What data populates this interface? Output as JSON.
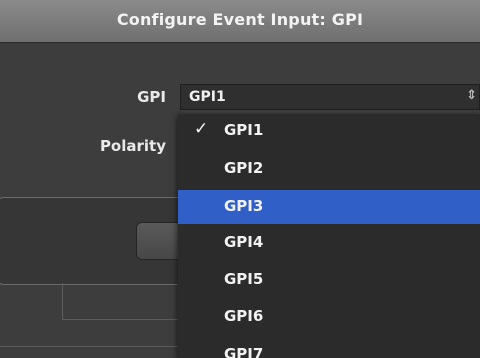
{
  "window": {
    "title": "Configure Event Input: GPI"
  },
  "form": {
    "gpi_label": "GPI",
    "gpi_value": "GPI1",
    "polarity_label": "Polarity"
  },
  "dropdown": {
    "checked_index": 0,
    "highlighted_index": 2,
    "check_glyph": "✓",
    "options": [
      "GPI1",
      "GPI2",
      "GPI3",
      "GPI4",
      "GPI5",
      "GPI6",
      "GPI7"
    ]
  },
  "colors": {
    "highlight": "#2f5fc7",
    "menu_bg": "#2b2b2b",
    "title_bar": "#7d7d7d"
  }
}
